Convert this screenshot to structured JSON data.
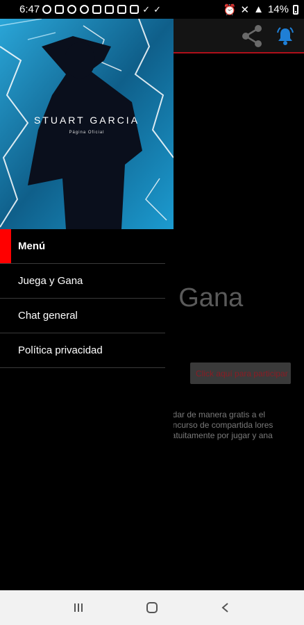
{
  "status_bar": {
    "time": "6:47",
    "battery": "14%"
  },
  "drawer": {
    "header_name": "STUART GARCIA",
    "header_sub": "Página Oficial",
    "items": [
      {
        "label": "Menú",
        "active": true
      },
      {
        "label": "Juega y Gana",
        "active": false
      },
      {
        "label": "Chat general",
        "active": false
      },
      {
        "label": "Política privacidad",
        "active": false
      }
    ]
  },
  "background": {
    "heading_partial": "a y Gana",
    "participate_button": "Click aquí para participar",
    "description_partial": "yudar de manera gratis a el concurso de compartida lores gratuitamente por jugar y ana"
  },
  "colors": {
    "accent_red": "#ff0000",
    "app_bar_line": "#b0101a",
    "bell_blue": "#1f7fd6"
  },
  "icons": {
    "share": "share-icon",
    "bell": "bell-icon",
    "nav_recent": "recent-apps-icon",
    "nav_home": "home-icon",
    "nav_back": "back-icon"
  }
}
